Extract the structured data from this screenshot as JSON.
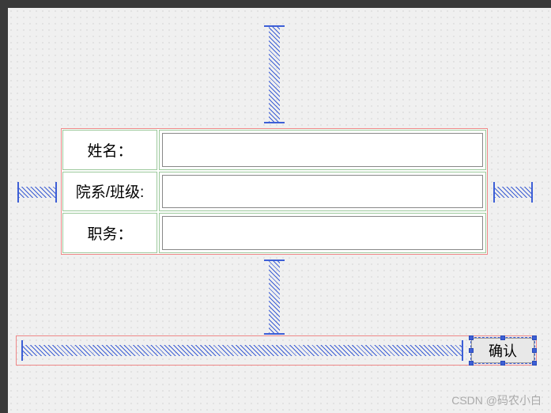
{
  "form": {
    "rows": [
      {
        "label": "姓名：",
        "value": ""
      },
      {
        "label": "院系/班级:",
        "value": ""
      },
      {
        "label": "职务：",
        "value": ""
      }
    ]
  },
  "button": {
    "ok_label": "确认"
  },
  "watermark": "CSDN @码农小白"
}
